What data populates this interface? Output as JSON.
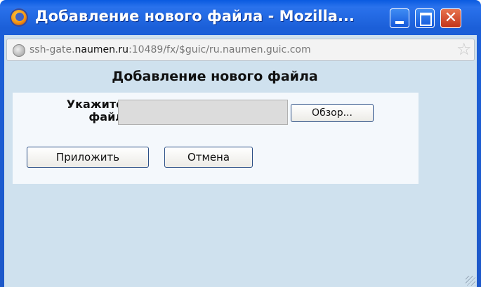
{
  "window": {
    "title": "Добавление нового файла - Mozilla...",
    "icon": "firefox-icon",
    "controls": {
      "minimize": "minimize-icon",
      "maximize": "maximize-icon",
      "close": "close-icon"
    }
  },
  "urlbar": {
    "prefix": "ssh-gate.",
    "host": "naumen.ru",
    "rest": ":10489/fx/$guic/ru.naumen.guic.com",
    "star": "☆"
  },
  "dialog": {
    "heading": "Добавление нового файла",
    "file_label_line1": "Укажите",
    "file_label_line2": "файл",
    "file_value": "",
    "browse_label": "Обзор...",
    "attach_label": "Приложить",
    "cancel_label": "Отмена"
  },
  "colors": {
    "titlebar": "#1b5fd8",
    "client_bg": "#cfe1ee",
    "panel_bg": "#f4f8fc",
    "close_button": "#c1331a"
  }
}
